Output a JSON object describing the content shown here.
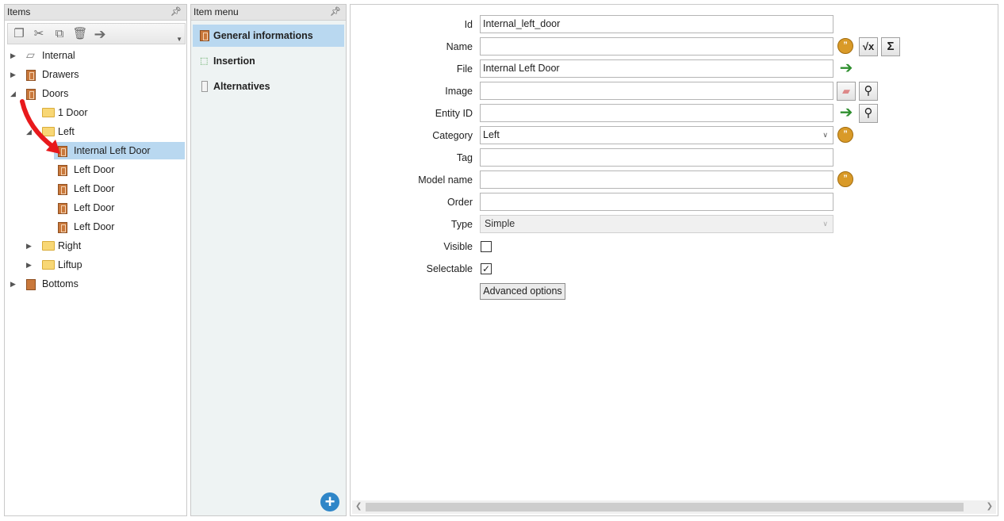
{
  "items_panel": {
    "title": "Items",
    "pin_icon": "pin-icon",
    "toolbar": [
      "copy-icon",
      "cut-icon",
      "duplicate-icon",
      "delete-icon",
      "move-right-icon"
    ],
    "tree": [
      {
        "label": "Internal",
        "icon": "paragraph-icon",
        "level": 0,
        "expand": "collapsed"
      },
      {
        "label": "Drawers",
        "icon": "drawer-icon",
        "level": 0,
        "expand": "collapsed"
      },
      {
        "label": "Doors",
        "icon": "door-icon",
        "level": 0,
        "expand": "expanded"
      },
      {
        "label": "1 Door",
        "icon": "folder-icon",
        "level": 1,
        "expand": "none"
      },
      {
        "label": "Left",
        "icon": "folder-icon",
        "level": 1,
        "expand": "expanded"
      },
      {
        "label": "Internal Left Door",
        "icon": "door-icon",
        "level": 2,
        "expand": "none",
        "selected": true
      },
      {
        "label": "Left Door",
        "icon": "door-icon",
        "level": 2,
        "expand": "none"
      },
      {
        "label": "Left Door",
        "icon": "door-icon",
        "level": 2,
        "expand": "none"
      },
      {
        "label": "Left Door",
        "icon": "door-icon",
        "level": 2,
        "expand": "none"
      },
      {
        "label": "Left Door",
        "icon": "door-icon",
        "level": 2,
        "expand": "none"
      },
      {
        "label": "Right",
        "icon": "folder-icon",
        "level": 1,
        "expand": "collapsed"
      },
      {
        "label": "Liftup",
        "icon": "folder-icon",
        "level": 1,
        "expand": "collapsed"
      },
      {
        "label": "Bottoms",
        "icon": "bottom-panel-icon",
        "level": 0,
        "expand": "collapsed"
      }
    ]
  },
  "menu_panel": {
    "title": "Item menu",
    "items": [
      {
        "label": "General informations",
        "icon": "door-icon",
        "active": true
      },
      {
        "label": "Insertion",
        "icon": "insertion-icon",
        "active": false
      },
      {
        "label": "Alternatives",
        "icon": "alternatives-icon",
        "active": false
      }
    ],
    "add_icon": "plus-circle-icon"
  },
  "form": {
    "id_label": "Id",
    "id_value": "Internal_left_door",
    "name_label": "Name",
    "name_value": "",
    "file_label": "File",
    "file_value": "Internal Left Door",
    "image_label": "Image",
    "image_value": "",
    "entity_label": "Entity ID",
    "entity_value": "",
    "category_label": "Category",
    "category_value": "Left",
    "tag_label": "Tag",
    "tag_value": "",
    "model_label": "Model name",
    "model_value": "",
    "order_label": "Order",
    "order_value": "",
    "type_label": "Type",
    "type_value": "Simple",
    "visible_label": "Visible",
    "visible_checked": false,
    "selectable_label": "Selectable",
    "selectable_checked": true,
    "advanced_label": "Advanced options"
  },
  "colors": {
    "selection": "#b9d8f0",
    "accent": "#2f86c8",
    "door": "#c9783b",
    "folder": "#f8d775"
  }
}
